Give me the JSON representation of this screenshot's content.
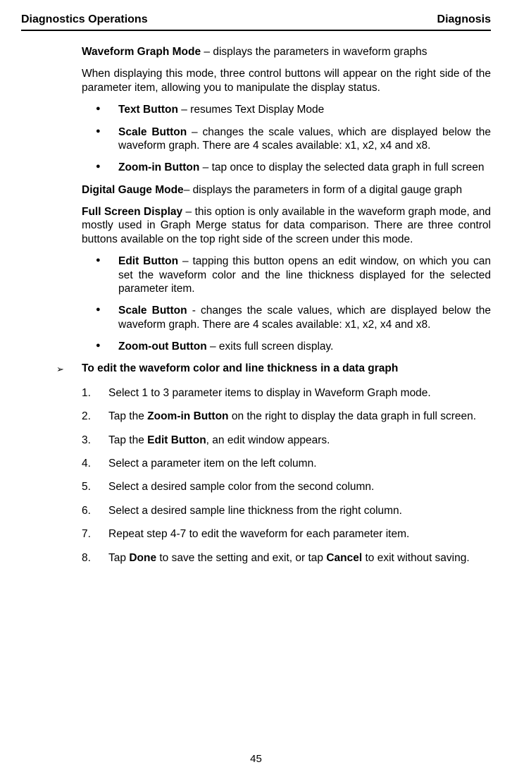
{
  "header": {
    "left": "Diagnostics Operations",
    "right": "Diagnosis"
  },
  "p1_lead": "Waveform Graph Mode",
  "p1_rest": " – displays the parameters in waveform graphs",
  "p2": "When displaying this mode, three control buttons will appear on the right side of the parameter item, allowing you to manipulate the display status.",
  "b1": [
    {
      "lead": "Text Button",
      "rest": " – resumes Text Display Mode"
    },
    {
      "lead": "Scale Button",
      "rest": " – changes the scale values, which are displayed below the waveform graph. There are 4 scales available: x1, x2, x4 and x8."
    },
    {
      "lead": "Zoom-in Button",
      "rest": " – tap once to display the selected data graph in full screen"
    }
  ],
  "p3_lead": "Digital Gauge Mode",
  "p3_rest": "– displays the parameters in form of a digital gauge graph",
  "p4_lead": "Full Screen Display",
  "p4_rest": " – this option is only available in the waveform graph mode, and mostly used in Graph Merge status for data comparison. There are three control buttons available on the top right side of the screen under this mode.",
  "b2": [
    {
      "lead": "Edit Button",
      "rest": " – tapping this button opens an edit window, on which you can set the waveform color and the line thickness displayed for the selected parameter item."
    },
    {
      "lead": "Scale Button",
      "rest": " - changes the scale values, which are displayed below the waveform graph. There are 4 scales available: x1, x2, x4 and x8."
    },
    {
      "lead": "Zoom-out Button",
      "rest": " – exits full screen display."
    }
  ],
  "arrow": "To edit the waveform color and line thickness in a data graph",
  "steps": [
    {
      "t": "Select 1 to 3 parameter items to display in Waveform Graph mode."
    },
    {
      "pre": "Tap the ",
      "b": "Zoom-in Button",
      "post": " on the right to display the data graph in full screen."
    },
    {
      "pre": "Tap the ",
      "b": "Edit Button",
      "post": ", an edit window appears."
    },
    {
      "t": "Select a parameter item on the left column."
    },
    {
      "t": "Select a desired sample color from the second column."
    },
    {
      "t": "Select a desired sample line thickness from the right column."
    },
    {
      "t": "Repeat step 4-7 to edit the waveform for each parameter item."
    },
    {
      "pre": "Tap ",
      "b": "Done",
      "mid": " to save the setting and exit, or tap ",
      "b2": "Cancel",
      "post": " to exit without saving."
    }
  ],
  "pageno": "45"
}
